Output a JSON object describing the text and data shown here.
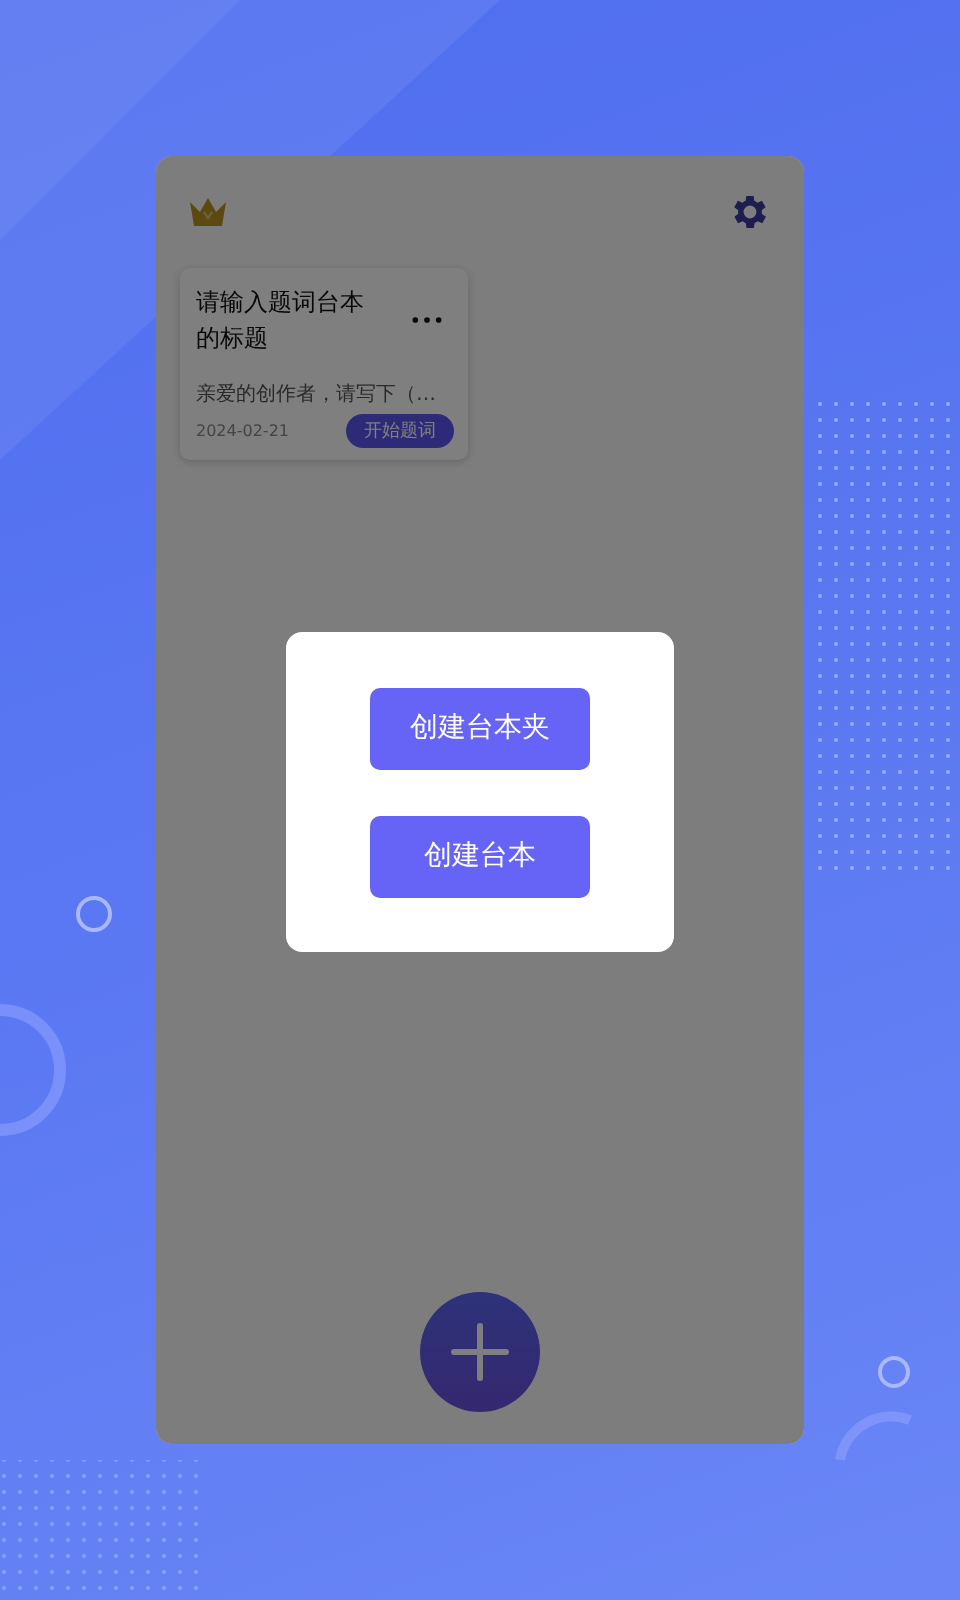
{
  "scripts": [
    {
      "title": "请输入题词台本的标题",
      "excerpt": "亲爱的创作者，请写下（…",
      "date": "2024-02-21",
      "action": "开始题词"
    }
  ],
  "dialog": {
    "open": true,
    "buttons": [
      "创建台本夹",
      "创建台本"
    ]
  }
}
